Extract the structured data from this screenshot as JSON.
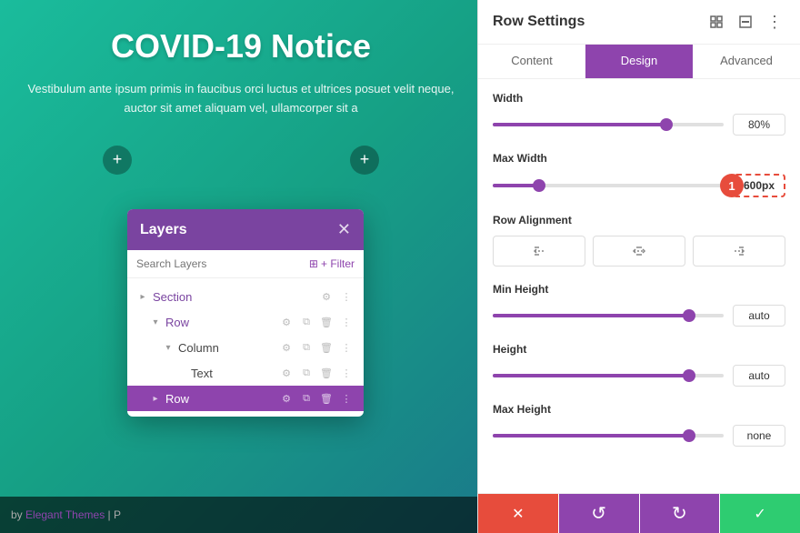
{
  "background": {
    "title": "COVID-19 Notice",
    "text": "Vestibulum ante ipsum primis in faucibus orci luctus et ultrices posuet velit neque, auctor sit amet aliquam vel, ullamcorper sit a"
  },
  "footer_bar": {
    "by_label": "by",
    "brand": "Elegant Themes",
    "separator": "|",
    "page_label": "P"
  },
  "layers": {
    "title": "Layers",
    "search_placeholder": "Search Layers",
    "filter_label": "+ Filter",
    "items": [
      {
        "name": "Section",
        "indent": 0,
        "type": "section"
      },
      {
        "name": "Row",
        "indent": 1,
        "type": "row"
      },
      {
        "name": "Column",
        "indent": 2,
        "type": "column"
      },
      {
        "name": "Text",
        "indent": 3,
        "type": "text"
      },
      {
        "name": "Row",
        "indent": 1,
        "type": "row-highlighted"
      }
    ]
  },
  "row_settings": {
    "title": "Row Settings",
    "tabs": [
      "Content",
      "Design",
      "Advanced"
    ],
    "active_tab": "Design",
    "sections": {
      "width": {
        "label": "Width",
        "value": "80%",
        "thumb_pos": "75"
      },
      "max_width": {
        "label": "Max Width",
        "value": "600px",
        "thumb_pos": "20",
        "badge": "1"
      },
      "row_alignment": {
        "label": "Row Alignment",
        "options": [
          "left",
          "center",
          "right"
        ]
      },
      "min_height": {
        "label": "Min Height",
        "value": "auto",
        "thumb_pos": "85"
      },
      "height": {
        "label": "Height",
        "value": "auto",
        "thumb_pos": "85"
      },
      "max_height": {
        "label": "Max Height",
        "value": "none",
        "thumb_pos": "85"
      }
    },
    "footer": {
      "cancel": "✕",
      "reset": "↺",
      "redo": "↻",
      "save": "✓"
    }
  }
}
